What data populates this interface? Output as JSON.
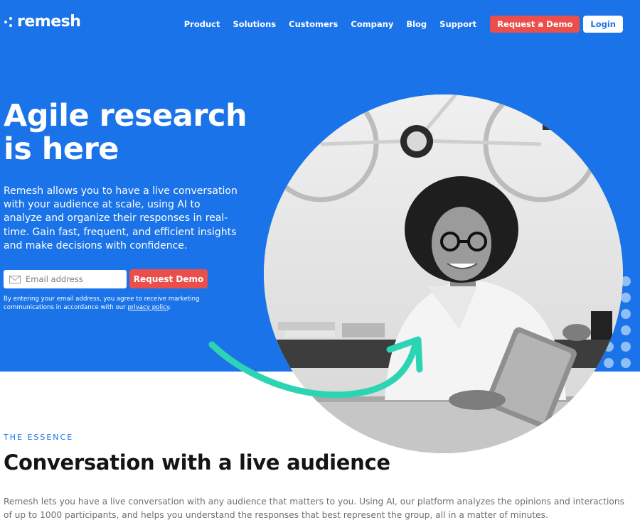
{
  "brand": {
    "name": "remesh",
    "primary_color": "#1a73e8",
    "accent_color": "#ea4f4b",
    "arrow_color": "#2dd4b4"
  },
  "nav": {
    "links": [
      "Product",
      "Solutions",
      "Customers",
      "Company",
      "Blog",
      "Support"
    ],
    "request_demo": "Request a Demo",
    "login": "Login"
  },
  "hero": {
    "title": "Agile research is here",
    "description": "Remesh allows you to have a live conversation with your audience at scale, using AI to analyze and organize their responses in real-time. Gain fast, frequent, and efficient insights and make decisions with confidence.",
    "email_placeholder": "Email address",
    "cta": "Request Demo",
    "disclaimer_prefix": "By entering your email address, you agree to receive marketing communications in accordance with our ",
    "privacy_link": "privacy policy",
    "disclaimer_suffix": "."
  },
  "essence": {
    "eyebrow": "THE ESSENCE",
    "title": "Conversation with a live audience",
    "body": "Remesh lets you have a live conversation with any audience that matters to you. Using AI, our platform analyzes the opinions and interactions of up to 1000 participants, and helps you understand the responses that best represent the group, all in a matter of minutes."
  },
  "icons": [
    "logo-dots-icon",
    "mail-icon",
    "curved-arrow-icon",
    "dot-grid-decoration"
  ]
}
